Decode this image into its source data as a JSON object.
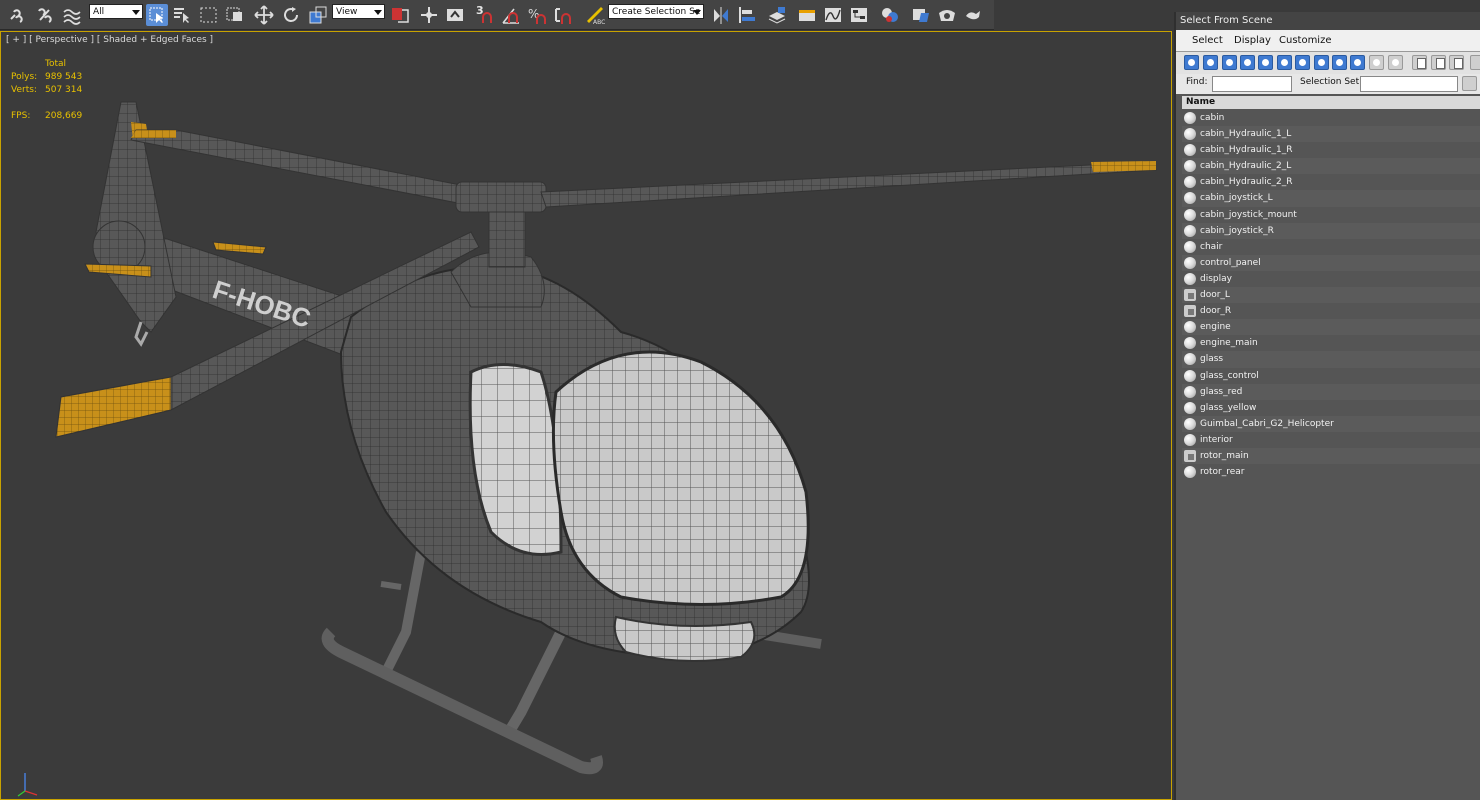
{
  "toolbar": {
    "selection_filter": "All",
    "reference_coord": "View",
    "snap_3d": "3",
    "named_selection_placeholder": "Create Selection Se"
  },
  "viewport": {
    "label": "[ + ] [ Perspective ] [ Shaded + Edged Faces ]",
    "stats": {
      "total_label": "Total",
      "polys_label": "Polys:",
      "polys_value": "989 543",
      "verts_label": "Verts:",
      "verts_value": "507 314",
      "fps_label": "FPS:",
      "fps_value": "208,669"
    },
    "model_text": "F-HOBC",
    "axis": {
      "x": "x",
      "y": "y",
      "z": "z"
    }
  },
  "scene_explorer": {
    "title": "Select From Scene",
    "menu": [
      "Select",
      "Display",
      "Customize"
    ],
    "find_label": "Find:",
    "selection_set_label": "Selection Set:",
    "column_header": "Name",
    "items": [
      {
        "name": "cabin",
        "type": "object"
      },
      {
        "name": "cabin_Hydraulic_1_L",
        "type": "object"
      },
      {
        "name": "cabin_Hydraulic_1_R",
        "type": "object"
      },
      {
        "name": "cabin_Hydraulic_2_L",
        "type": "object"
      },
      {
        "name": "cabin_Hydraulic_2_R",
        "type": "object"
      },
      {
        "name": "cabin_joystick_L",
        "type": "object"
      },
      {
        "name": "cabin_joystick_mount",
        "type": "object"
      },
      {
        "name": "cabin_joystick_R",
        "type": "object"
      },
      {
        "name": "chair",
        "type": "object"
      },
      {
        "name": "control_panel",
        "type": "object"
      },
      {
        "name": "display",
        "type": "object"
      },
      {
        "name": "door_L",
        "type": "group"
      },
      {
        "name": "door_R",
        "type": "group"
      },
      {
        "name": "engine",
        "type": "object"
      },
      {
        "name": "engine_main",
        "type": "object"
      },
      {
        "name": "glass",
        "type": "object"
      },
      {
        "name": "glass_control",
        "type": "object"
      },
      {
        "name": "glass_red",
        "type": "object"
      },
      {
        "name": "glass_yellow",
        "type": "object"
      },
      {
        "name": "Guimbal_Cabri_G2_Helicopter",
        "type": "object"
      },
      {
        "name": "interior",
        "type": "object"
      },
      {
        "name": "rotor_main",
        "type": "group"
      },
      {
        "name": "rotor_rear",
        "type": "object"
      }
    ]
  }
}
